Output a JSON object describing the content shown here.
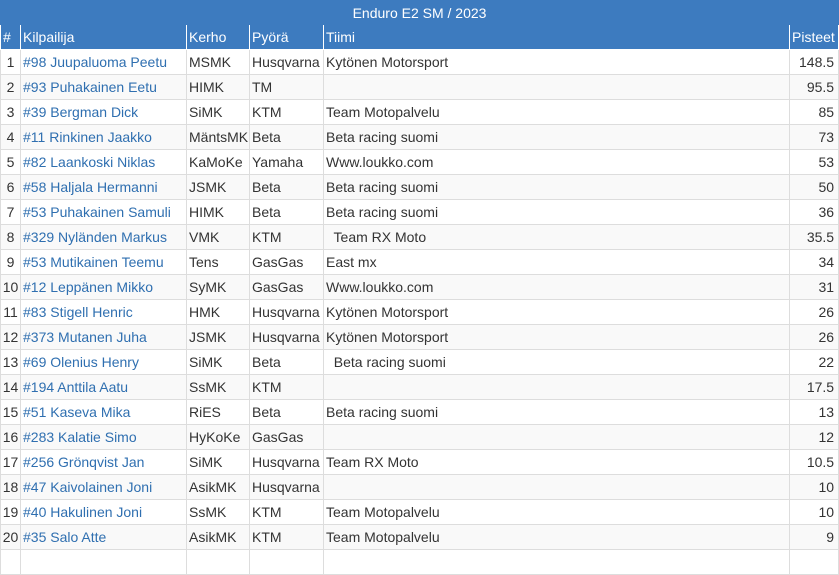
{
  "caption": "Enduro E2 SM / 2023",
  "columns": {
    "rank": "#",
    "rider": "Kilpailija",
    "club": "Kerho",
    "bike": "Pyörä",
    "team": "Tiimi",
    "points": "Pisteet"
  },
  "rows": [
    {
      "rank": "1",
      "rider": "#98 Juupaluoma Peetu",
      "club": "MSMK",
      "bike": "Husqvarna",
      "team": "Kytönen Motorsport",
      "points": "148.5"
    },
    {
      "rank": "2",
      "rider": "#93 Puhakainen Eetu",
      "club": "HIMK",
      "bike": "TM",
      "team": "",
      "points": "95.5"
    },
    {
      "rank": "3",
      "rider": "#39 Bergman Dick",
      "club": "SiMK",
      "bike": "KTM",
      "team": "Team Motopalvelu",
      "points": "85"
    },
    {
      "rank": "4",
      "rider": "#11 Rinkinen Jaakko",
      "club": "MäntsMK",
      "bike": "Beta",
      "team": "Beta racing suomi",
      "points": "73"
    },
    {
      "rank": "5",
      "rider": "#82 Laankoski Niklas",
      "club": "KaMoKe",
      "bike": "Yamaha",
      "team": "Www.loukko.com",
      "points": "53"
    },
    {
      "rank": "6",
      "rider": "#58 Haljala Hermanni",
      "club": "JSMK",
      "bike": "Beta",
      "team": "Beta racing suomi",
      "points": "50"
    },
    {
      "rank": "7",
      "rider": "#53 Puhakainen Samuli",
      "club": "HIMK",
      "bike": "Beta",
      "team": "Beta racing suomi",
      "points": "36"
    },
    {
      "rank": "8",
      "rider": "#329 Nyländen Markus",
      "club": "VMK",
      "bike": "KTM",
      "team": "  Team RX Moto",
      "points": "35.5"
    },
    {
      "rank": "9",
      "rider": "#53 Mutikainen Teemu",
      "club": "Tens",
      "bike": "GasGas",
      "team": "East mx",
      "points": "34"
    },
    {
      "rank": "10",
      "rider": "#12 Leppänen Mikko",
      "club": "SyMK",
      "bike": "GasGas",
      "team": "Www.loukko.com",
      "points": "31"
    },
    {
      "rank": "11",
      "rider": "#83 Stigell Henric",
      "club": "HMK",
      "bike": "Husqvarna",
      "team": "Kytönen Motorsport",
      "points": "26"
    },
    {
      "rank": "12",
      "rider": "#373 Mutanen Juha",
      "club": "JSMK",
      "bike": "Husqvarna",
      "team": "Kytönen Motorsport",
      "points": "26"
    },
    {
      "rank": "13",
      "rider": "#69 Olenius Henry",
      "club": "SiMK",
      "bike": "Beta",
      "team": "  Beta racing suomi",
      "points": "22"
    },
    {
      "rank": "14",
      "rider": "#194 Anttila Aatu",
      "club": "SsMK",
      "bike": "KTM",
      "team": "",
      "points": "17.5"
    },
    {
      "rank": "15",
      "rider": "#51 Kaseva Mika",
      "club": "RiES",
      "bike": "Beta",
      "team": "Beta racing suomi",
      "points": "13"
    },
    {
      "rank": "16",
      "rider": "#283 Kalatie Simo",
      "club": "HyKoKe",
      "bike": "GasGas",
      "team": "",
      "points": "12"
    },
    {
      "rank": "17",
      "rider": "#256 Grönqvist Jan",
      "club": "SiMK",
      "bike": "Husqvarna",
      "team": "Team RX Moto",
      "points": "10.5"
    },
    {
      "rank": "18",
      "rider": "#47 Kaivolainen Joni",
      "club": "AsikMK",
      "bike": "Husqvarna",
      "team": "",
      "points": "10"
    },
    {
      "rank": "19",
      "rider": "#40 Hakulinen Joni",
      "club": "SsMK",
      "bike": "KTM",
      "team": "Team Motopalvelu",
      "points": "10"
    },
    {
      "rank": "20",
      "rider": "#35 Salo Atte",
      "club": "AsikMK",
      "bike": "KTM",
      "team": "Team Motopalvelu",
      "points": "9"
    }
  ],
  "colors": {
    "header_bg": "#3d7bbf",
    "link": "#2f6fb0",
    "row_alt": "#f9f9f9",
    "border": "#dddddd"
  }
}
